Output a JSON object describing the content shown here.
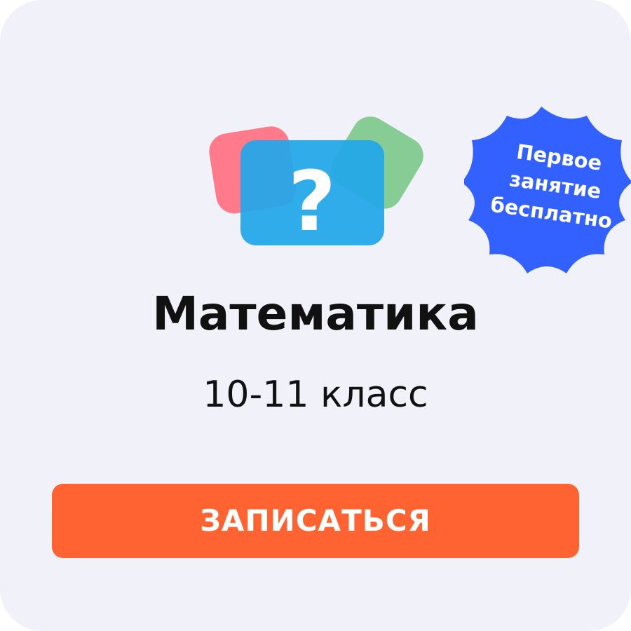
{
  "card": {
    "title": "Математика",
    "subtitle": "10-11 класс"
  },
  "badge": {
    "line1": "Первое",
    "line2": "занятие",
    "line3": "бесплатно",
    "color": "#3361ff"
  },
  "illustration": {
    "icon": "question-mark-icon",
    "glyph": "?",
    "colors": {
      "left_card": "#ff7a8a",
      "right_card": "#86cc94",
      "front_card": "#22a7ea"
    }
  },
  "cta": {
    "label": "ЗАПИСАТЬСЯ",
    "color": "#ff6331"
  },
  "theme": {
    "background": "#f1f1fa",
    "text": "#111111"
  }
}
